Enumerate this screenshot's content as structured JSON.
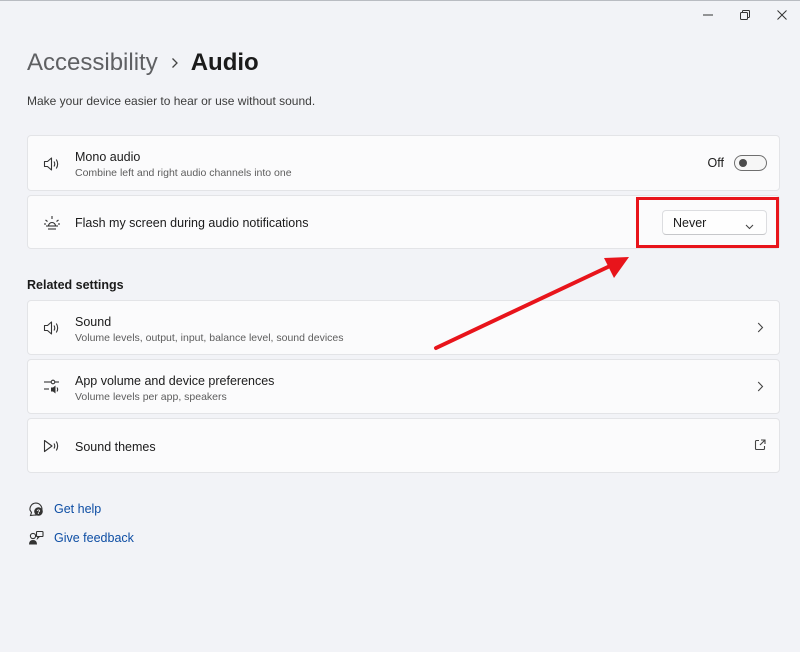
{
  "window": {
    "caption": {
      "minimize_icon": "minimize-icon",
      "maximize_icon": "restore-icon",
      "close_icon": "close-icon"
    }
  },
  "header": {
    "parent": "Accessibility",
    "current": "Audio",
    "subtitle": "Make your device easier to hear or use without sound."
  },
  "settings": {
    "mono_audio": {
      "title": "Mono audio",
      "description": "Combine left and right audio channels into one",
      "state_label": "Off",
      "icon": "speaker-icon"
    },
    "flash_screen": {
      "title": "Flash my screen during audio notifications",
      "selected": "Never",
      "icon": "brightness-icon"
    }
  },
  "related": {
    "heading": "Related settings",
    "items": [
      {
        "title": "Sound",
        "description": "Volume levels, output, input, balance level, sound devices",
        "icon": "speaker-icon"
      },
      {
        "title": "App volume and device preferences",
        "description": "Volume levels per app, speakers",
        "icon": "mixer-icon"
      },
      {
        "title": "Sound themes",
        "icon": "sound-theme-icon",
        "action_icon": "open-external-icon"
      }
    ]
  },
  "footer_links": {
    "help": "Get help",
    "feedback": "Give feedback"
  },
  "annotation": {
    "color": "#e8141b"
  },
  "colors": {
    "accent_link": "#0e4ea4",
    "background": "#f2f3f7",
    "card": "#fbfbfc"
  }
}
